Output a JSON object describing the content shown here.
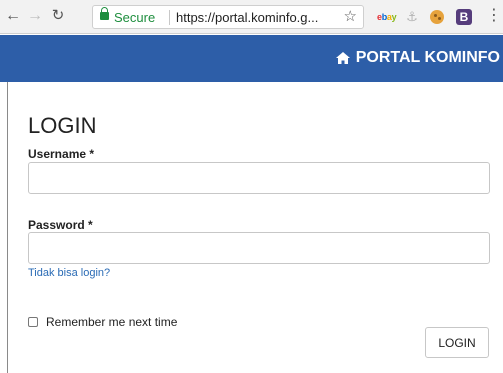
{
  "browser": {
    "secure_label": "Secure",
    "url": "https://portal.kominfo.g...",
    "extensions": [
      "ebay-icon",
      "ship-icon",
      "cookie-icon",
      "bootstrap-icon"
    ],
    "bootstrap_letter": "B",
    "ebay_letters": [
      "e",
      "b",
      "a",
      "y"
    ]
  },
  "header": {
    "brand": "PORTAL KOMINFO",
    "color": "#2d5ea8"
  },
  "form": {
    "title": "LOGIN",
    "username_label": "Username *",
    "username_value": "",
    "password_label": "Password *",
    "password_value": "",
    "forgot_link": "Tidak bisa login?",
    "remember_label": "Remember me next time",
    "remember_checked": false,
    "submit_label": "LOGIN"
  }
}
